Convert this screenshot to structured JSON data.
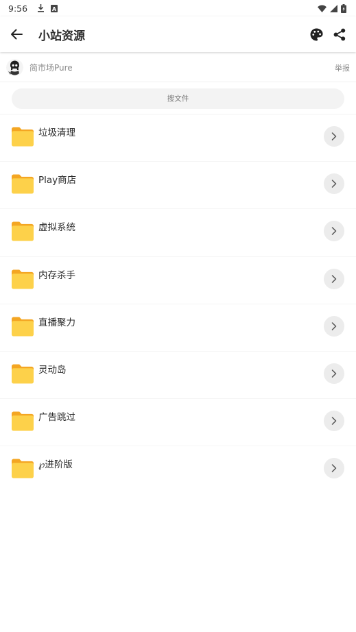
{
  "status_bar": {
    "time": "9:56",
    "left_icons": [
      "download-icon",
      "a-box-icon"
    ],
    "right_icons": [
      "wifi-icon",
      "signal-icon",
      "battery-icon"
    ]
  },
  "app_bar": {
    "back_icon": "arrow-left-icon",
    "title": "小站资源",
    "actions": [
      "palette-icon",
      "share-icon"
    ]
  },
  "owner": {
    "name": "简市场Pure",
    "report_label": "举报"
  },
  "search": {
    "placeholder": "搜文件"
  },
  "folders": [
    {
      "label": "垃圾清理"
    },
    {
      "label": "Play商店"
    },
    {
      "label": "虚拟系统"
    },
    {
      "label": "内存杀手"
    },
    {
      "label": "直播聚力"
    },
    {
      "label": "灵动岛"
    },
    {
      "label": "广告跳过"
    },
    {
      "label": "℘进阶版"
    }
  ],
  "colors": {
    "folder_front": "#FDD14A",
    "folder_back": "#F4A623",
    "chevron_bg": "#ECECEC",
    "search_bg": "#F3F3F3"
  }
}
